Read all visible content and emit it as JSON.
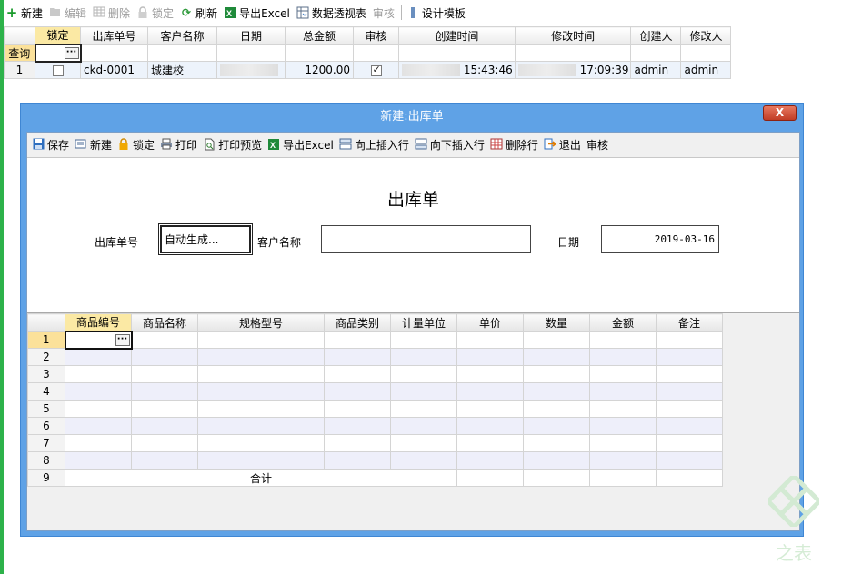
{
  "main_toolbar": [
    {
      "label": "新建",
      "icon": "plus-icon",
      "enabled": true
    },
    {
      "label": "编辑",
      "icon": "folder-open-icon",
      "enabled": false
    },
    {
      "label": "删除",
      "icon": "grid-delete-icon",
      "enabled": false
    },
    {
      "label": "锁定",
      "icon": "lock-icon",
      "enabled": false
    },
    {
      "label": "刷新",
      "icon": "refresh-icon",
      "enabled": true
    },
    {
      "label": "导出Excel",
      "icon": "excel-icon",
      "enabled": true
    },
    {
      "label": "数据透视表",
      "icon": "pivot-table-icon",
      "enabled": true
    },
    {
      "label": "审核",
      "icon": "",
      "enabled": false
    },
    {
      "label": "设计模板",
      "icon": "design-template-icon",
      "enabled": true
    }
  ],
  "main_grid": {
    "query_label": "查询",
    "columns": [
      "锁定",
      "出库单号",
      "客户名称",
      "日期",
      "总金额",
      "审核",
      "创建时间",
      "修改时间",
      "创建人",
      "修改人"
    ],
    "rows": [
      {
        "row_number": "1",
        "locked": false,
        "order_no": "ckd-0001",
        "customer": "城建校",
        "date": "",
        "total": "1200.00",
        "approved": true,
        "created_time": "15:43:46",
        "modified_time": "17:09:39",
        "creator": "admin",
        "modifier": "admin"
      }
    ]
  },
  "dialog": {
    "title": "新建:出库单",
    "close_label": "X",
    "toolbar": [
      {
        "label": "保存",
        "icon": "save-icon"
      },
      {
        "label": "新建",
        "icon": "new-doc-icon"
      },
      {
        "label": "锁定",
        "icon": "lock-icon"
      },
      {
        "label": "打印",
        "icon": "printer-icon"
      },
      {
        "label": "打印预览",
        "icon": "print-preview-icon"
      },
      {
        "label": "导出Excel",
        "icon": "excel-icon"
      },
      {
        "label": "向上插入行",
        "icon": "insert-row-above-icon"
      },
      {
        "label": "向下插入行",
        "icon": "insert-row-below-icon"
      },
      {
        "label": "删除行",
        "icon": "delete-row-icon"
      },
      {
        "label": "退出",
        "icon": "exit-icon"
      },
      {
        "label": "审核",
        "icon": ""
      }
    ],
    "form": {
      "heading": "出库单",
      "order_no_label": "出库单号",
      "order_no_value": "自动生成...",
      "customer_label": "客户名称",
      "customer_value": "",
      "date_label": "日期",
      "date_value": "2019-03-16"
    },
    "detail_grid": {
      "columns": [
        "商品编号",
        "商品名称",
        "规格型号",
        "商品类别",
        "计量单位",
        "单价",
        "数量",
        "金额",
        "备注"
      ],
      "row_numbers": [
        "1",
        "2",
        "3",
        "4",
        "5",
        "6",
        "7",
        "8"
      ],
      "total_row_number": "9",
      "total_label": "合计"
    }
  },
  "watermark": {
    "text": "之表"
  }
}
